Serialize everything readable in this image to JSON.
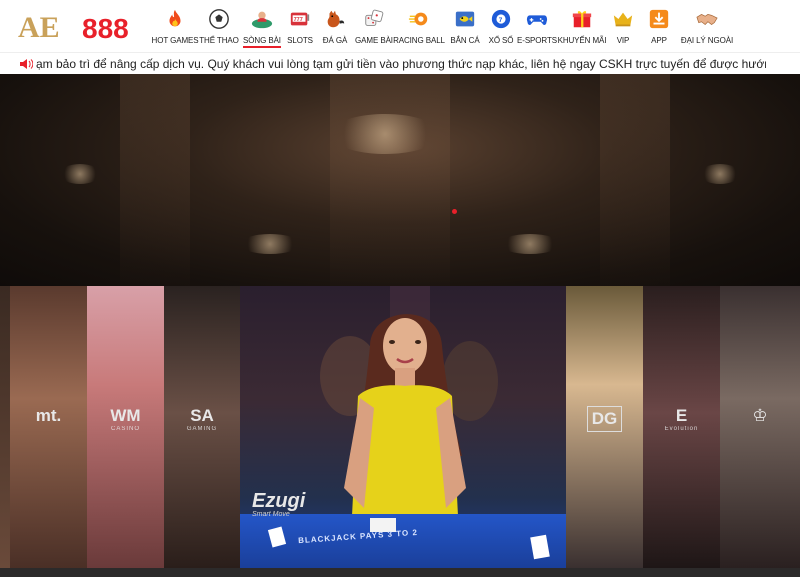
{
  "header": {
    "logo_prefix": "AE",
    "logo_number": "888",
    "nav": [
      {
        "label": "HOT GAMES",
        "icon": "flame-icon",
        "active": false
      },
      {
        "label": "THỂ THAO",
        "icon": "soccer-ball-icon",
        "active": false
      },
      {
        "label": "SÒNG BÀI",
        "icon": "casino-dealer-icon",
        "active": true
      },
      {
        "label": "SLOTS",
        "icon": "slot-machine-icon",
        "active": false
      },
      {
        "label": "ĐÁ GÀ",
        "icon": "rooster-icon",
        "active": false
      },
      {
        "label": "GAME BÀI",
        "icon": "dice-icon",
        "active": false
      },
      {
        "label": "RACING BALL",
        "icon": "racing-ball-icon",
        "active": false
      },
      {
        "label": "BẮN CÁ",
        "icon": "fish-icon",
        "active": false
      },
      {
        "label": "XỔ SỐ",
        "icon": "lottery-ball-icon",
        "active": false
      },
      {
        "label": "E-SPORTS",
        "icon": "gamepad-icon",
        "active": false
      },
      {
        "label": "KHUYẾN MÃI",
        "icon": "gift-icon",
        "active": false
      },
      {
        "label": "VIP",
        "icon": "crown-icon",
        "active": false
      },
      {
        "label": "APP",
        "icon": "download-icon",
        "active": false
      },
      {
        "label": "ĐẠI LÝ NGOÀI",
        "icon": "handshake-icon",
        "active": false
      }
    ]
  },
  "ticker": {
    "icon": "speaker-icon",
    "text": "ạm bảo trì để nâng cấp dịch vụ. Quý khách vui lòng tạm gửi tiền vào phương thức nạp khác, liên hệ ngay CSKH trực tuyến để được hướng"
  },
  "providers_left": [
    {
      "mark": "mt.",
      "sub": ""
    },
    {
      "mark": "WM",
      "sub": "CASINO"
    },
    {
      "mark": "SA",
      "sub": "GAMING"
    }
  ],
  "featured": {
    "brand": "Ezugi",
    "tagline": "Smart Move",
    "table_text": "BLACKJACK PAYS 3 TO 2"
  },
  "providers_right": [
    {
      "mark": "DG",
      "sub": ""
    },
    {
      "mark": "E",
      "sub": "Evolution"
    },
    {
      "mark": "♔",
      "sub": ""
    }
  ],
  "colors": {
    "brand_gold": "#c9a15a",
    "brand_red": "#e8202a",
    "active_underline": "#e8202a"
  }
}
